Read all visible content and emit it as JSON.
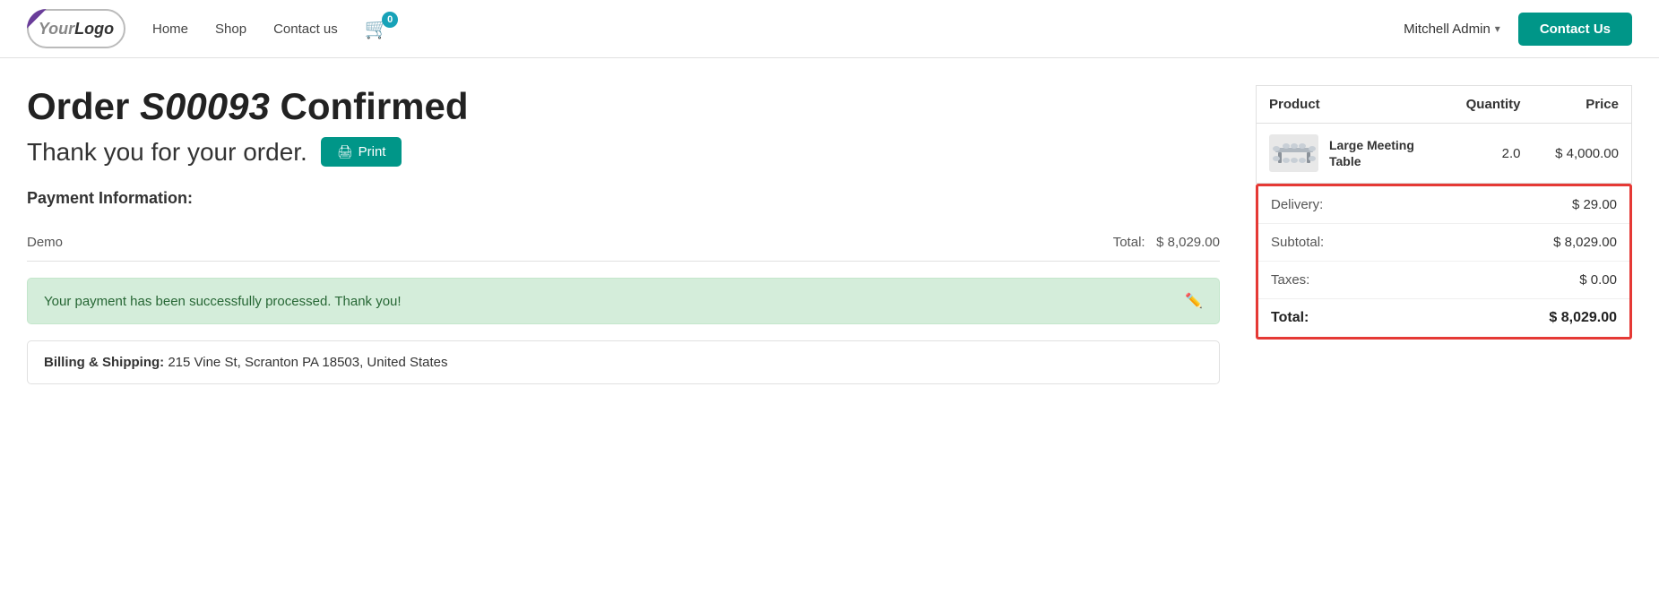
{
  "header": {
    "logo_your": "Your",
    "logo_logo": "Logo",
    "nav": {
      "home": "Home",
      "shop": "Shop",
      "contact_us_nav": "Contact us"
    },
    "cart_count": "0",
    "user_name": "Mitchell Admin",
    "contact_button": "Contact Us"
  },
  "main": {
    "order_title_prefix": "Order ",
    "order_number": "S00093",
    "order_title_suffix": " Confirmed",
    "thank_you": "Thank you for your order.",
    "print_label": "Print",
    "payment_section_title": "Payment Information:",
    "payment_method": "Demo",
    "payment_total_label": "Total:",
    "payment_total_value": "$ 8,029.00",
    "success_message": "Your payment has been successfully processed. Thank you!",
    "billing_label": "Billing & Shipping:",
    "billing_address": "215 Vine St, Scranton PA 18503, United States"
  },
  "order_table": {
    "col_product": "Product",
    "col_quantity": "Quantity",
    "col_price": "Price",
    "items": [
      {
        "name": "Large Meeting Table",
        "quantity": "2.0",
        "price": "$ 4,000.00"
      }
    ]
  },
  "summary": {
    "delivery_label": "Delivery:",
    "delivery_value": "$ 29.00",
    "subtotal_label": "Subtotal:",
    "subtotal_value": "$ 8,029.00",
    "taxes_label": "Taxes:",
    "taxes_value": "$ 0.00",
    "total_label": "Total:",
    "total_value": "$ 8,029.00"
  }
}
